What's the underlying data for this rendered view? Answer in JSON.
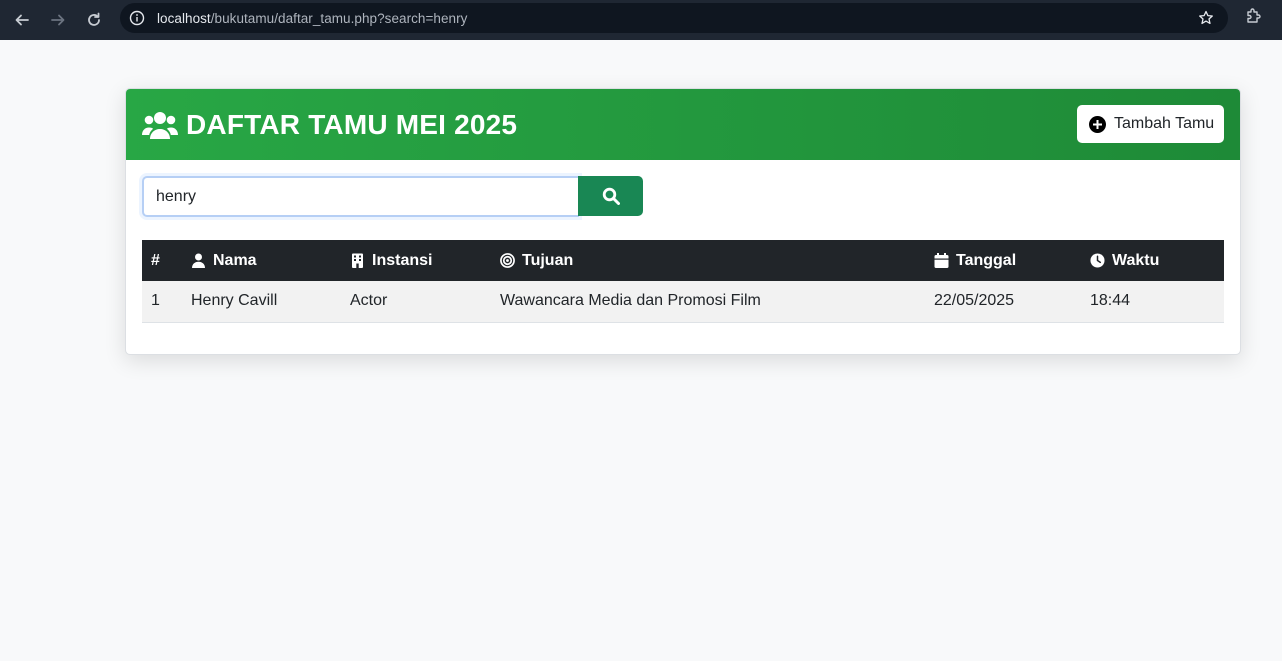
{
  "browser": {
    "url_host": "localhost",
    "url_path": "/bukutamu/daftar_tamu.php?search=henry"
  },
  "header": {
    "title": "DAFTAR TAMU MEI 2025",
    "add_button_label": "Tambah Tamu"
  },
  "search": {
    "value": "henry"
  },
  "table": {
    "columns": [
      "#",
      "Nama",
      "Instansi",
      "Tujuan",
      "Tanggal",
      "Waktu"
    ],
    "rows": [
      {
        "no": "1",
        "nama": "Henry Cavill",
        "instansi": "Actor",
        "tujuan": "Wawancara Media dan Promosi Film",
        "tanggal": "22/05/2025",
        "waktu": "18:44"
      }
    ]
  },
  "colors": {
    "header_green": "#28a745",
    "search_button": "#198754",
    "table_head": "#212529"
  },
  "icons": {
    "title": "users-icon",
    "add": "plus-circle-icon",
    "search": "search-icon",
    "nama": "user-icon",
    "instansi": "building-icon",
    "tujuan": "bullseye-icon",
    "tanggal": "calendar-icon",
    "waktu": "clock-icon"
  }
}
